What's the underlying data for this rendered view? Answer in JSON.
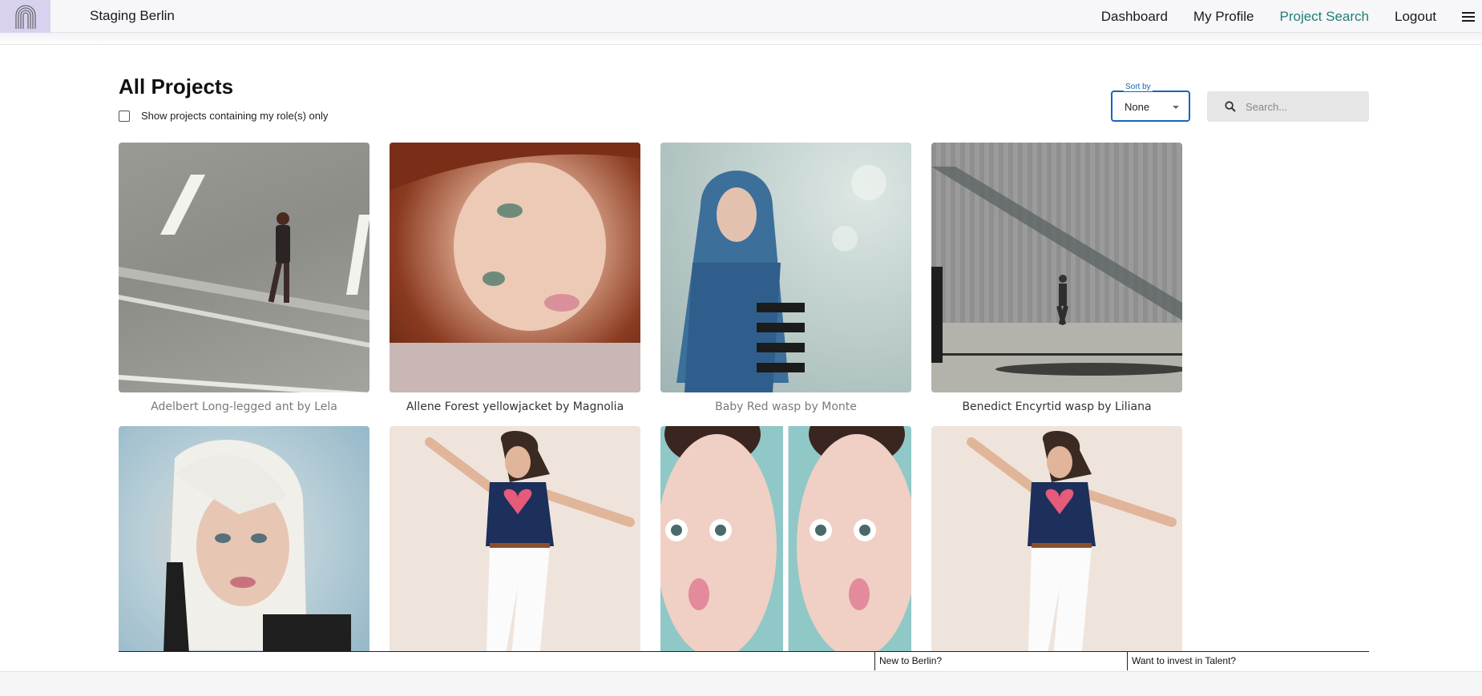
{
  "app": {
    "title": "Staging Berlin"
  },
  "nav": {
    "items": [
      {
        "label": "Dashboard",
        "active": false
      },
      {
        "label": "My Profile",
        "active": false
      },
      {
        "label": "Project Search",
        "active": true
      },
      {
        "label": "Logout",
        "active": false
      }
    ],
    "active_color": "#1f7f79"
  },
  "page": {
    "title": "All Projects",
    "filter_label": "Show projects containing my role(s) only",
    "filter_checked": false
  },
  "sort": {
    "legend": "Sort by",
    "value": "None"
  },
  "search": {
    "placeholder": "Search..."
  },
  "projects": [
    {
      "caption": "Adelbert Long-legged ant by Lela",
      "muted": true,
      "image": "man-walking-street"
    },
    {
      "caption": "Allene Forest yellowjacket by Magnolia",
      "muted": false,
      "image": "redhead-portrait"
    },
    {
      "caption": "Baby Red wasp by Monte",
      "muted": true,
      "image": "woman-hooded-scarf"
    },
    {
      "caption": "Benedict Encyrtid wasp by Liliana",
      "muted": false,
      "image": "man-walking-wall"
    },
    {
      "caption": "",
      "muted": false,
      "image": "blonde-portrait"
    },
    {
      "caption": "",
      "muted": false,
      "image": "woman-jumping"
    },
    {
      "caption": "",
      "muted": false,
      "image": "split-face-portrait"
    },
    {
      "caption": "",
      "muted": false,
      "image": "woman-jumping"
    }
  ],
  "footer": {
    "new_to": "New to Berlin?",
    "invest": "Want to invest in Talent?"
  },
  "icons": {
    "logo": "arch-logo-icon",
    "menu": "hamburger-menu-icon",
    "search": "search-icon",
    "sort_caret": "caret-down-icon"
  }
}
